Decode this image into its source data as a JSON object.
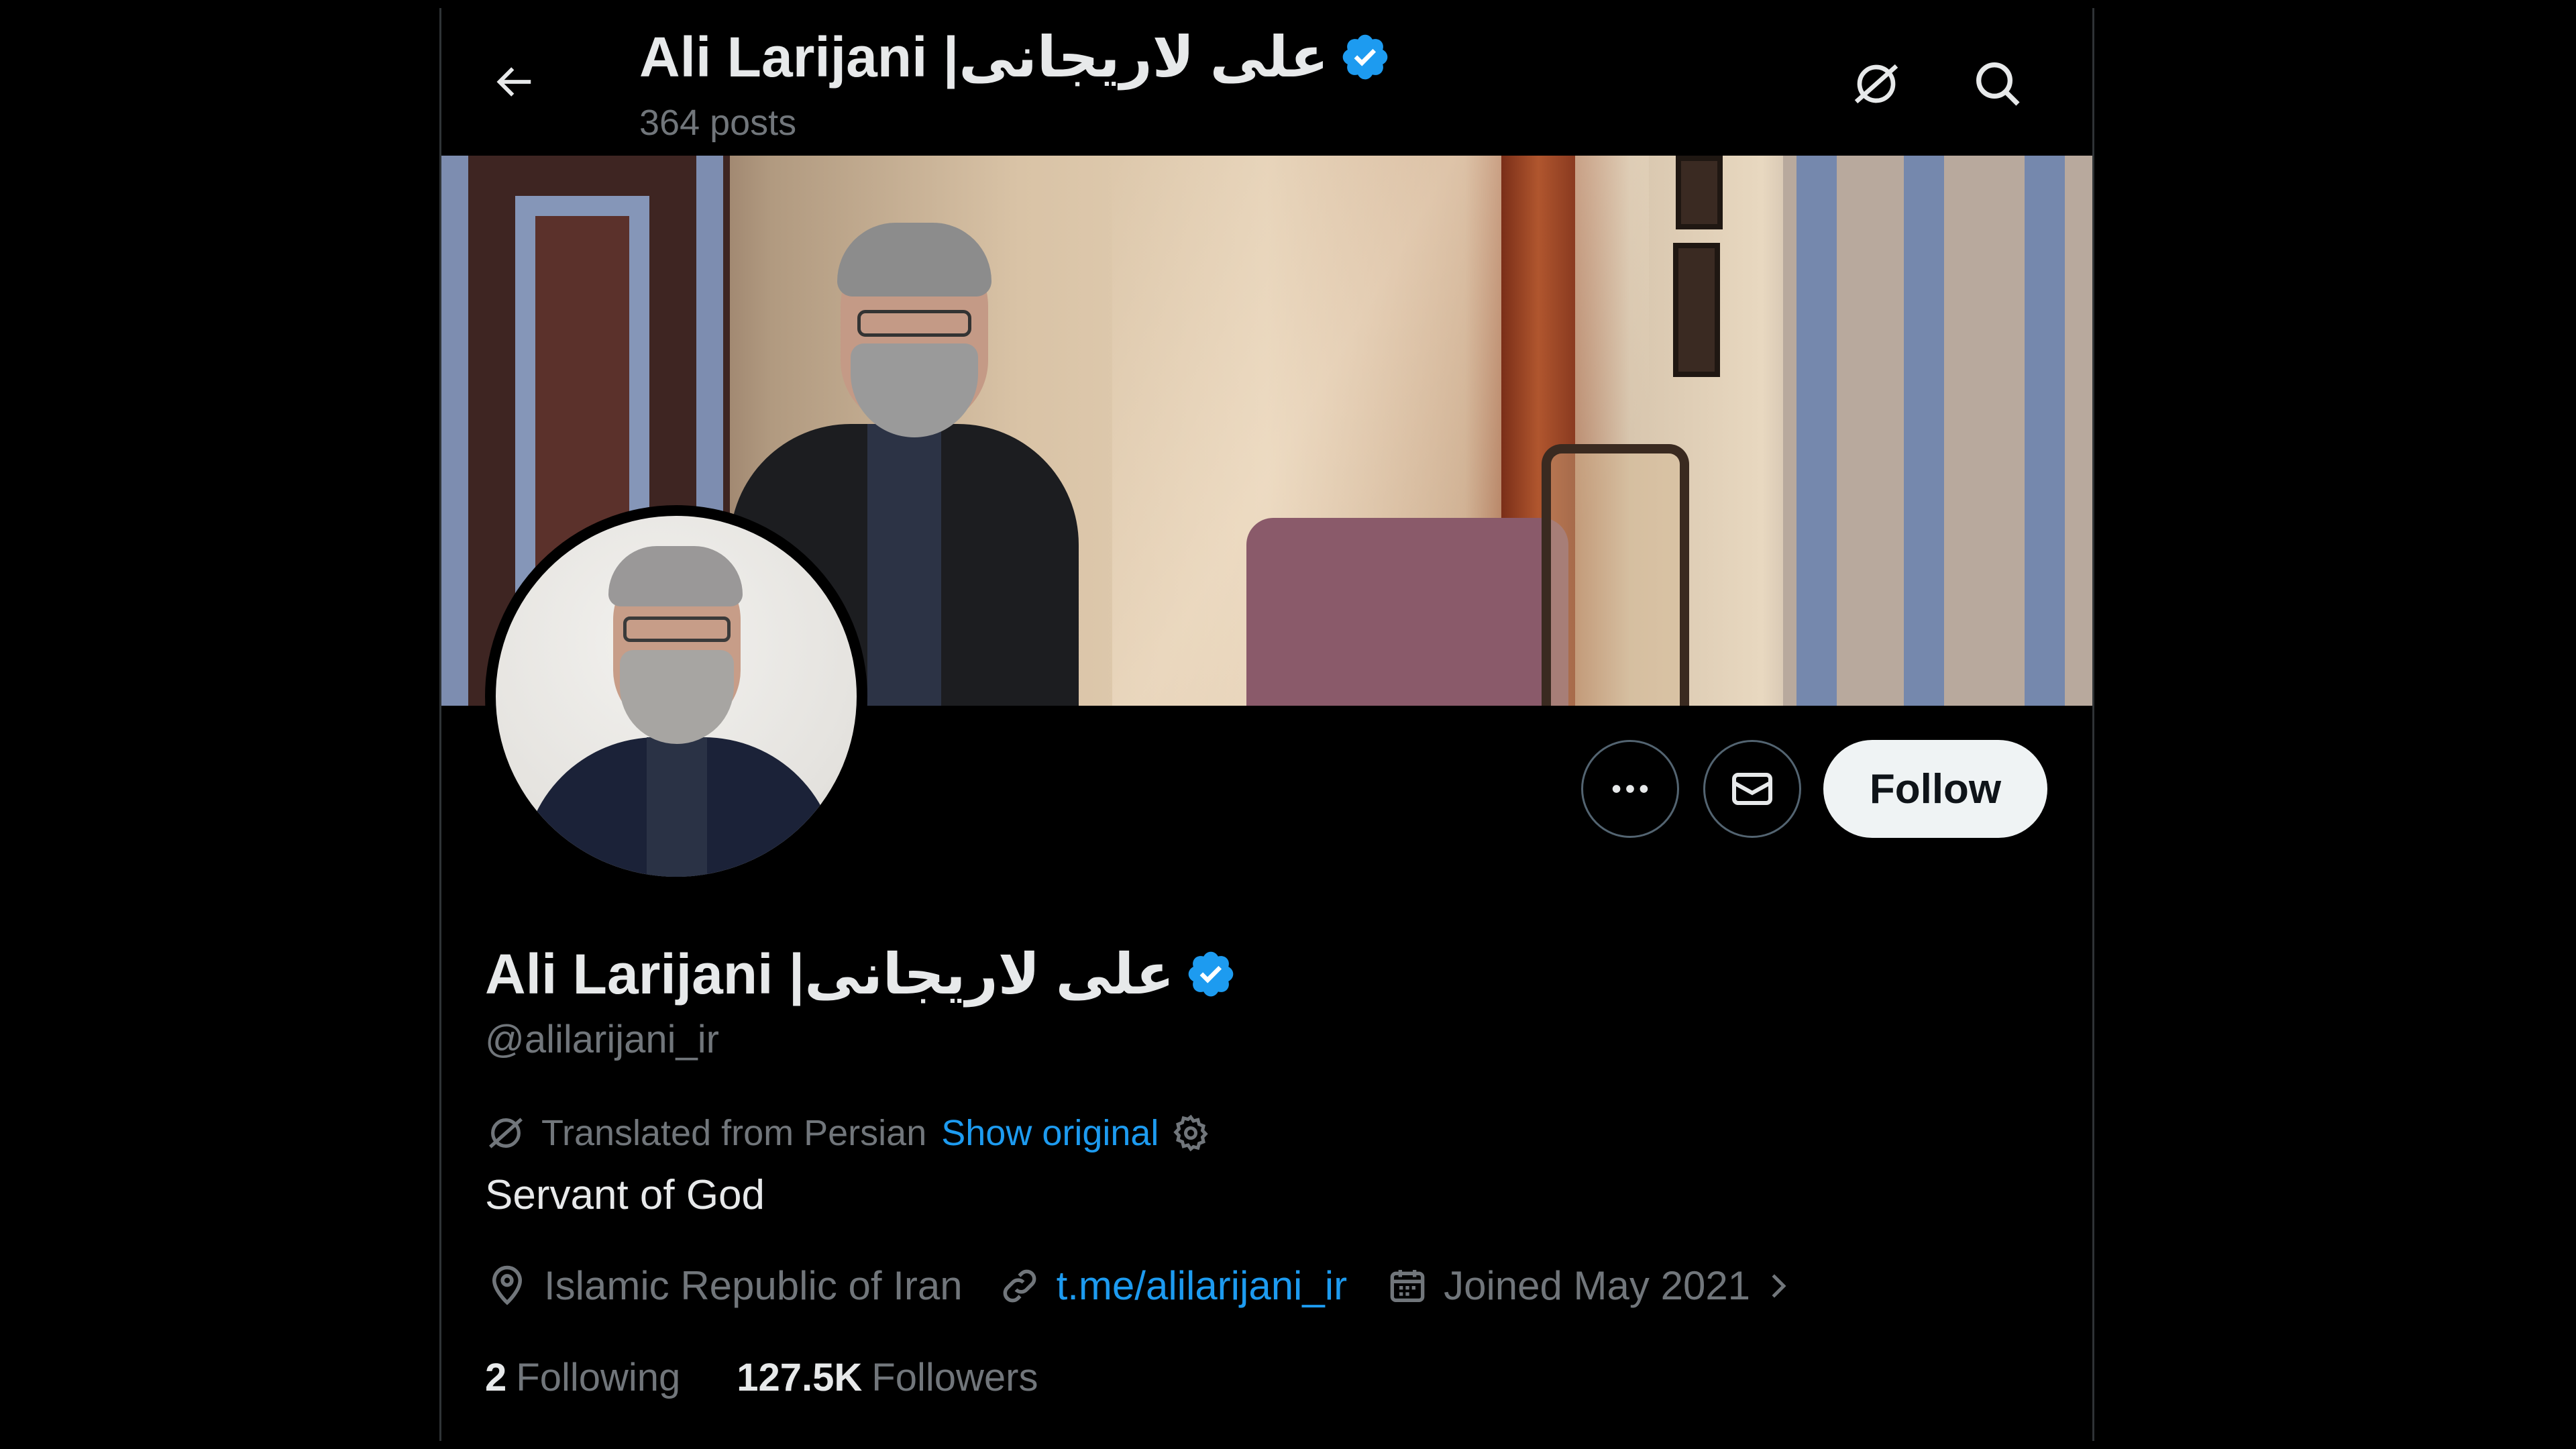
{
  "header": {
    "name_en": "Ali Larijani | ",
    "name_ar": "علی لاریجانی",
    "posts_label": "364 posts"
  },
  "icons": {
    "back": "arrow-left-icon",
    "translate": "no-translate-icon",
    "search": "search-icon",
    "more": "more-horizontal-icon",
    "message": "mail-icon",
    "verified": "verified-badge-icon",
    "location": "location-pin-icon",
    "link": "link-icon",
    "calendar": "calendar-icon",
    "settings": "gear-icon"
  },
  "actions": {
    "follow_label": "Follow"
  },
  "profile": {
    "name_en": "Ali Larijani | ",
    "name_ar": "علی لاریجانی",
    "handle": "@alilarijani_ir",
    "translated_label": "Translated from Persian",
    "show_original_label": "Show original",
    "bio": "Servant of God",
    "location": "Islamic Republic of Iran",
    "website": "t.me/alilarijani_ir",
    "joined": "Joined May 2021",
    "following_count": "2",
    "following_label": "Following",
    "followers_count": "127.5K",
    "followers_label": "Followers"
  },
  "colors": {
    "background": "#000000",
    "accent": "#1d9bf0",
    "muted": "#71767b",
    "text": "#e7e9ea",
    "follow_bg": "#eff3f4"
  }
}
